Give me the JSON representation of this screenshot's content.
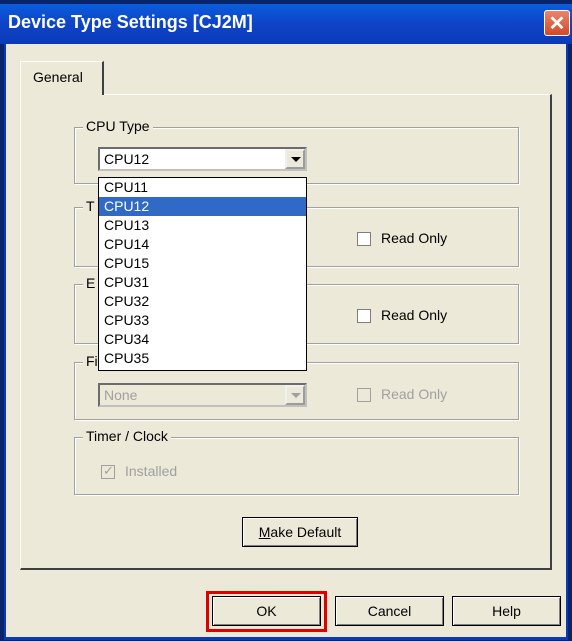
{
  "window": {
    "title": "Device Type Settings [CJ2M]",
    "close_glyph": "✕"
  },
  "tabs": [
    {
      "label": "General",
      "active": true
    }
  ],
  "cpu_type": {
    "label": "CPU Type",
    "selected": "CPU12",
    "options": [
      "CPU11",
      "CPU12",
      "CPU13",
      "CPU14",
      "CPU15",
      "CPU31",
      "CPU32",
      "CPU33",
      "CPU34",
      "CPU35"
    ]
  },
  "group2": {
    "label_visible": "T",
    "read_only_label": "Read Only",
    "read_only_checked": false
  },
  "group3": {
    "label_visible": "E",
    "read_only_label": "Read Only",
    "read_only_checked": false
  },
  "group4": {
    "label_visible": "Fi",
    "combo_value": "None",
    "read_only_label": "Read Only",
    "disabled": true
  },
  "timer_clock": {
    "label": "Timer / Clock",
    "installed_label": "Installed",
    "installed_checked": true,
    "disabled": true
  },
  "buttons": {
    "make_default": "Make Default",
    "make_default_accel": "M",
    "make_default_rest": "ake Default",
    "ok": "OK",
    "cancel": "Cancel",
    "help": "Help"
  },
  "colors": {
    "titlebar": "#0f45c9",
    "selection": "#316ac5",
    "highlight_border": "#e00000",
    "dialog_bg": "#ece9d8"
  }
}
